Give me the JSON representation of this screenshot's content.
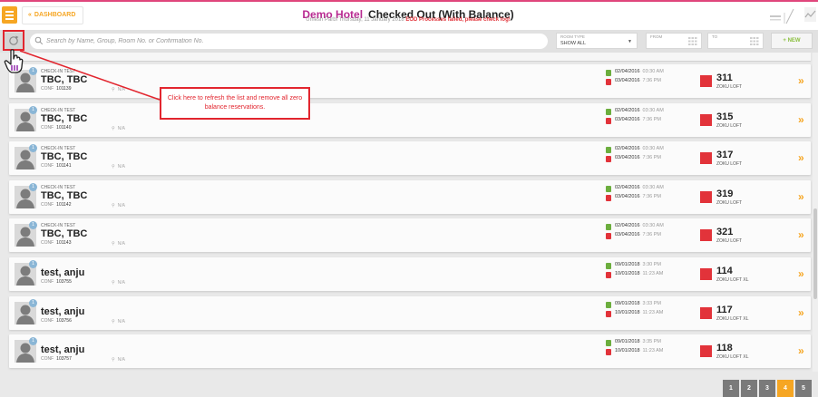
{
  "header": {
    "dashboard_label": "DASHBOARD",
    "hotel_name": "Demo Hotel",
    "page_title": "Checked Out (With Balance)",
    "user": "Umesh Parbi",
    "date": "Thursday, 11 January 2018",
    "eod_warning": "EOD Processes failed, please check log!"
  },
  "filters": {
    "search_placeholder": "Search by Name, Group, Room No. or Confirmation No.",
    "room_type_label": "ROOM TYPE",
    "room_type_value": "SHOW ALL",
    "from_label": "FROM",
    "to_label": "TO",
    "new_label": "+ NEW"
  },
  "callout": {
    "text": "Click here to refresh the list and remove all zero balance reservations."
  },
  "reservations": [
    {
      "badge": "1",
      "group": "CHECK-IN TEST",
      "guest": "TBC, TBC",
      "conf_label": "CONF",
      "conf": "101139",
      "location": "N/A",
      "arrival_date": "02/04/2016",
      "arrival_time": "03:30 AM",
      "departure_date": "03/04/2016",
      "departure_time": "7:36 PM",
      "room": "311",
      "room_type": "ZOKU LOFT"
    },
    {
      "badge": "1",
      "group": "CHECK-IN TEST",
      "guest": "TBC, TBC",
      "conf_label": "CONF",
      "conf": "101140",
      "location": "N/A",
      "arrival_date": "02/04/2016",
      "arrival_time": "03:30 AM",
      "departure_date": "03/04/2016",
      "departure_time": "7:36 PM",
      "room": "315",
      "room_type": "ZOKU LOFT"
    },
    {
      "badge": "1",
      "group": "CHECK-IN TEST",
      "guest": "TBC, TBC",
      "conf_label": "CONF",
      "conf": "101141",
      "location": "N/A",
      "arrival_date": "02/04/2016",
      "arrival_time": "03:30 AM",
      "departure_date": "03/04/2016",
      "departure_time": "7:36 PM",
      "room": "317",
      "room_type": "ZOKU LOFT"
    },
    {
      "badge": "1",
      "group": "CHECK-IN TEST",
      "guest": "TBC, TBC",
      "conf_label": "CONF",
      "conf": "101142",
      "location": "N/A",
      "arrival_date": "02/04/2016",
      "arrival_time": "03:30 AM",
      "departure_date": "03/04/2016",
      "departure_time": "7:36 PM",
      "room": "319",
      "room_type": "ZOKU LOFT"
    },
    {
      "badge": "1",
      "group": "CHECK-IN TEST",
      "guest": "TBC, TBC",
      "conf_label": "CONF",
      "conf": "101143",
      "location": "N/A",
      "arrival_date": "02/04/2016",
      "arrival_time": "03:30 AM",
      "departure_date": "03/04/2016",
      "departure_time": "7:36 PM",
      "room": "321",
      "room_type": "ZOKU LOFT"
    },
    {
      "badge": "1",
      "group": "",
      "guest": "test, anju",
      "conf_label": "CONF",
      "conf": "103755",
      "location": "N/A",
      "arrival_date": "09/01/2018",
      "arrival_time": "3:30 PM",
      "departure_date": "10/01/2018",
      "departure_time": "11:23 AM",
      "room": "114",
      "room_type": "ZOKU LOFT XL"
    },
    {
      "badge": "1",
      "group": "",
      "guest": "test, anju",
      "conf_label": "CONF",
      "conf": "103756",
      "location": "N/A",
      "arrival_date": "09/01/2018",
      "arrival_time": "3:33 PM",
      "departure_date": "10/01/2018",
      "departure_time": "11:23 AM",
      "room": "117",
      "room_type": "ZOKU LOFT XL"
    },
    {
      "badge": "1",
      "group": "",
      "guest": "test, anju",
      "conf_label": "CONF",
      "conf": "103757",
      "location": "N/A",
      "arrival_date": "09/01/2018",
      "arrival_time": "3:35 PM",
      "departure_date": "10/01/2018",
      "departure_time": "11:23 AM",
      "room": "118",
      "room_type": "ZOKU LOFT XL"
    }
  ],
  "pagination": {
    "pages": [
      "1",
      "2",
      "3",
      "4",
      "5"
    ],
    "active": "4"
  },
  "colors": {
    "accent": "#f6a623",
    "brand": "#b82a91",
    "alert": "#e2333a",
    "arrival": "#6cae3e"
  }
}
